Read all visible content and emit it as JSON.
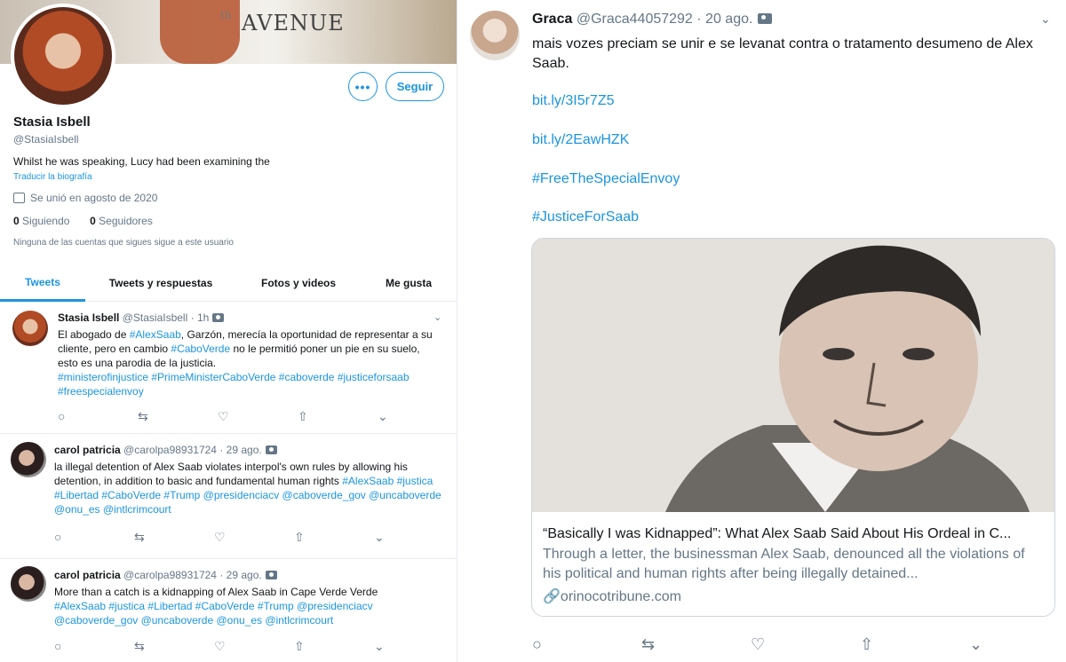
{
  "profile": {
    "banner_text": "AVENUE",
    "banner_small": "th",
    "more_label": "•••",
    "follow_label": "Seguir",
    "name": "Stasia Isbell",
    "handle": "@StasiaIsbell",
    "bio": "Whilst he was speaking, Lucy had been examining the",
    "translate_label": "Traducir la biografía",
    "joined": "Se unió en agosto de 2020",
    "following_count": "0",
    "following_label": "Siguiendo",
    "followers_count": "0",
    "followers_label": "Seguidores",
    "note": "Ninguna de las cuentas que sigues sigue a este usuario"
  },
  "tabs": [
    {
      "label": "Tweets",
      "active": true
    },
    {
      "label": "Tweets y respuestas"
    },
    {
      "label": "Fotos y videos"
    },
    {
      "label": "Me gusta"
    }
  ],
  "tweets": [
    {
      "name": "Stasia Isbell",
      "handle": "@StasiaIsbell",
      "time": "· 1h",
      "text_1": "El abogado de ",
      "tag_1": "#AlexSaab",
      "text_2": ", Garzón, merecía la oportunidad de representar a su cliente, pero en cambio ",
      "tag_2": "#CaboVerde",
      "text_3": " no le permitió poner un pie en su suelo, esto es una parodia de la justicia.",
      "tags": "#ministerofinjustice #PrimeMinisterCaboVerde #caboverde #justiceforsaab #freespecialenvoy"
    },
    {
      "name": "carol patricia",
      "handle": "@carolpa98931724",
      "time": "· 29 ago.",
      "text_1": "la illegal detention of Alex Saab violates interpol's own rules by allowing his detention, in addition to basic and fundamental human rights ",
      "tags": "#AlexSaab #justica #Libertad #CaboVerde #Trump @presidenciacv @caboverde_gov @uncaboverde @onu_es @intlcrimcourt"
    },
    {
      "name": "carol patricia",
      "handle": "@carolpa98931724",
      "time": "· 29 ago.",
      "text_1": "More than a catch is a kidnapping of Alex Saab in Cape Verde Verde",
      "tags": "#AlexSaab #justica #Libertad #CaboVerde #Trump @presidenciacv @caboverde_gov @uncaboverde @onu_es @intlcrimcourt"
    }
  ],
  "main_tweet": {
    "name": "Graca",
    "handle": "@Graca44057292",
    "time": "· 20 ago.",
    "text": "mais vozes preciam se unir e se levanat contra o tratamento desumeno de Alex Saab.",
    "links": [
      "bit.ly/3I5r7Z5",
      "bit.ly/2EawHZK",
      "#FreeTheSpecialEnvoy",
      "#JusticeForSaab"
    ],
    "card": {
      "title": "“Basically I was Kidnapped”: What Alex Saab Said About His Ordeal in C...",
      "description": "Through a letter, the businessman Alex Saab, denounced all the violations of his political and human rights after being illegally detained...",
      "domain": "orinocotribune.com"
    }
  },
  "icons": {
    "reply": "○",
    "retweet": "⇆",
    "like": "♡",
    "share": "⇧",
    "save": "⌄",
    "chevron": "⌄"
  },
  "colors": {
    "accent": "#1b95e0",
    "muted": "#657786",
    "text": "#14171a",
    "border": "#e6ecf0"
  }
}
